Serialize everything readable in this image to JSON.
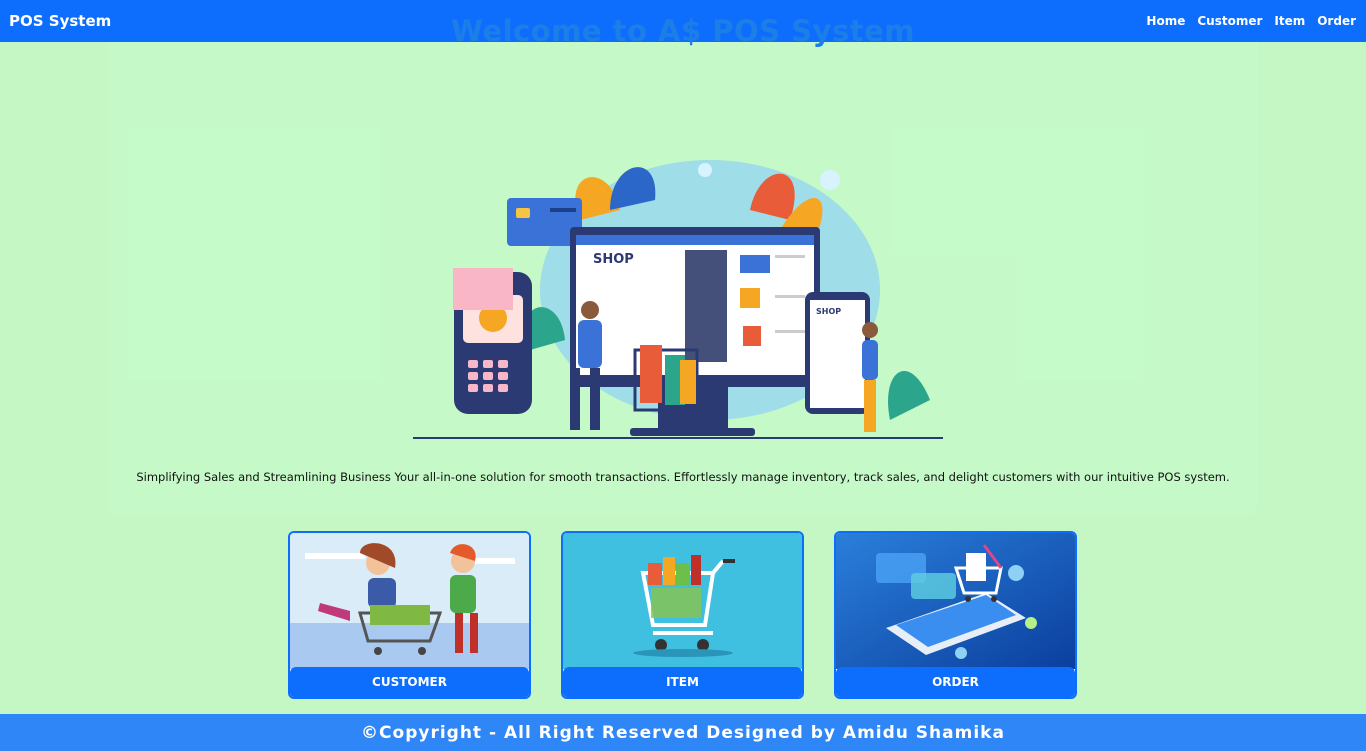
{
  "navbar": {
    "brand": "POS System",
    "links": [
      "Home",
      "Customer",
      "Item",
      "Order"
    ]
  },
  "hero": {
    "title": "Welcome to A$ POS System",
    "illustration_labels": {
      "shop_big": "SHOP",
      "shop_small": "SHOP"
    },
    "description": "Simplifying Sales and Streamlining Business Your all-in-one solution for smooth transactions. Effortlessly manage inventory, track sales, and delight customers with our intuitive POS system."
  },
  "cards": [
    {
      "label": "CUSTOMER",
      "icon": "shopping-couple-illustration"
    },
    {
      "label": "ITEM",
      "icon": "grocery-cart-illustration"
    },
    {
      "label": "ORDER",
      "icon": "mobile-order-illustration"
    }
  ],
  "footer": {
    "text": "©Copyright - All Right Reserved Designed by Amidu Shamika"
  },
  "colors": {
    "primary": "#0d6efd",
    "background": "#c4f7c4",
    "title": "#1d7ee8",
    "footer": "#2f86f6"
  }
}
